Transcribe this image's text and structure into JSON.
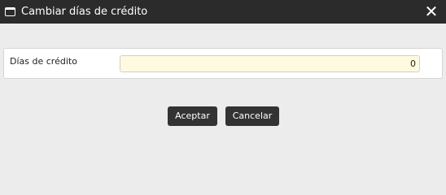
{
  "dialog": {
    "title": "Cambiar días de crédito",
    "close_icon": "close-icon",
    "window_icon": "window-icon"
  },
  "form": {
    "credit_days_label": "Días de crédito",
    "credit_days_value": "0"
  },
  "actions": {
    "accept_label": "Aceptar",
    "cancel_label": "Cancelar"
  },
  "colors": {
    "titlebar": "#2b2b2b",
    "input_background": "#fefadf",
    "button": "#333333"
  }
}
